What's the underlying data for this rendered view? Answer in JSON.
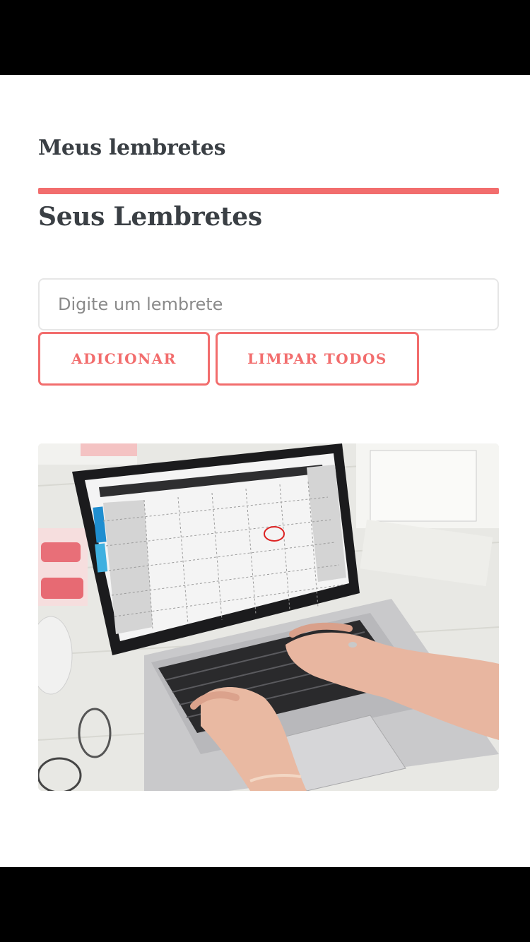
{
  "app": {
    "title": "Meus lembretes"
  },
  "main": {
    "section_title": "Seus Lembretes",
    "input": {
      "placeholder": "Digite um lembrete",
      "value": ""
    },
    "add_button_label": "ADICIONAR",
    "clear_button_label": "LIMPAR TODOS"
  },
  "colors": {
    "accent": "#f26d6d",
    "text": "#3a3f44",
    "background": "#ffffff"
  }
}
